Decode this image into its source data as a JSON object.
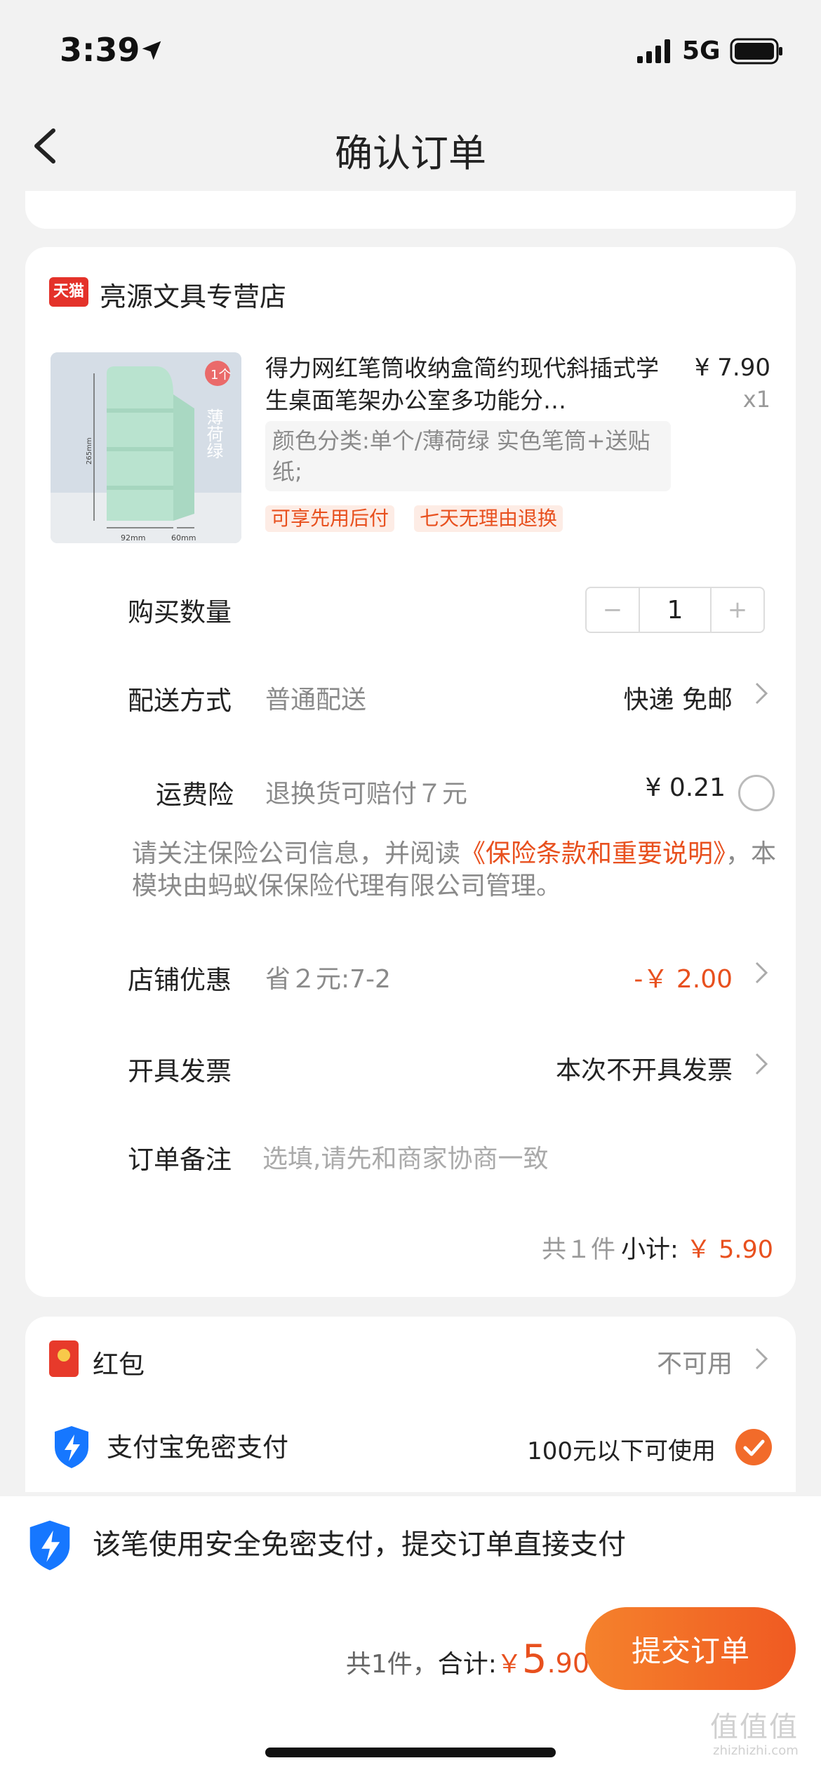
{
  "status": {
    "time": "3:39",
    "network": "5G"
  },
  "nav": {
    "title": "确认订单"
  },
  "store": {
    "name": "亮源文具专营店",
    "badge": "天猫",
    "product": {
      "title": "得力网红笔筒收纳盒简约现代斜插式学生桌面笔架办公室多功能分…",
      "price": "¥ 7.90",
      "quantity_x": "x1",
      "sku": "颜色分类:单个/薄荷绿 实色笔筒+送贴纸;",
      "tags": [
        "可享先用后付",
        "七天无理由退换"
      ],
      "image_label": "薄荷绿",
      "image_badge": "1个",
      "image_dims": [
        "92mm",
        "60mm",
        "265mm"
      ]
    },
    "quantity": {
      "label": "购买数量",
      "value": "1",
      "minus": "−",
      "plus": "+"
    },
    "delivery": {
      "label": "配送方式",
      "sub": "普通配送",
      "value": "快递 免邮"
    },
    "insurance": {
      "label": "运费险",
      "sub": "退换货可赔付７元",
      "value": "¥ 0.21",
      "note_prefix": "请关注保险公司信息，并阅读",
      "note_link": "《保险条款和重要说明》",
      "note_suffix": "，本模块由蚂蚁保保险代理有限公司管理。"
    },
    "discount": {
      "label": "店铺优惠",
      "sub": "省２元:7-2",
      "value": "-￥ 2.00"
    },
    "invoice": {
      "label": "开具发票",
      "value": "本次不开具发票"
    },
    "remark": {
      "label": "订单备注",
      "placeholder": "选填,请先和商家协商一致"
    },
    "subtotal": {
      "count": "共１件",
      "label": "小计:",
      "amount": "￥ 5.90"
    }
  },
  "payment": {
    "hongbao": {
      "label": "红包",
      "value": "不可用"
    },
    "alipay": {
      "label": "支付宝免密支付",
      "value": "100元以下可使用"
    }
  },
  "bottom": {
    "secure_note": "该笔使用安全免密支付，提交订单直接支付",
    "count": "共1件，",
    "total_label": "合计:",
    "yen": "￥",
    "total_int": "5",
    "total_dec": ".90",
    "submit": "提交订单",
    "watermark": "值值值",
    "watermark_sub": "zhizhizhi.com"
  },
  "colors": {
    "accent": "#f05a22",
    "tmall": "#e4322a",
    "alipay": "#1677ff"
  }
}
